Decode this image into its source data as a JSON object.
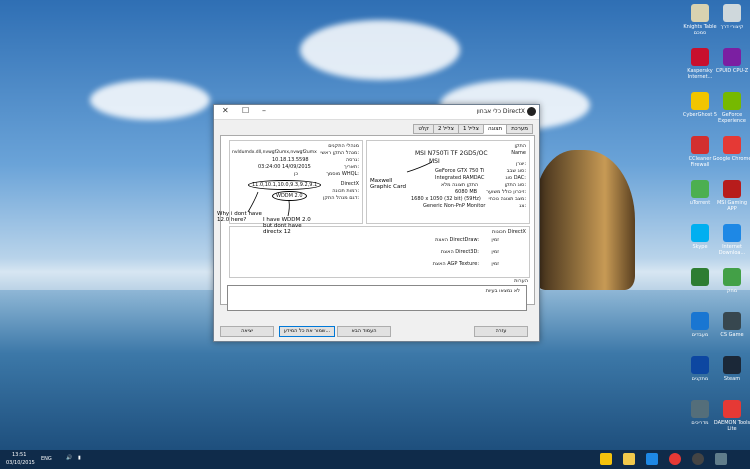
{
  "desktop_icons": [
    {
      "label": "Knights Table סמכם",
      "color": "#d9d2b0",
      "icon": "folder-icon"
    },
    {
      "label": "Kaspersky Internet...",
      "color": "#c8102e",
      "icon": "kaspersky-icon"
    },
    {
      "label": "CyberGhost 5",
      "color": "#f2c500",
      "icon": "cyberghost-icon"
    },
    {
      "label": "CCleaner Firewall",
      "color": "#d32f2f",
      "icon": "ccleaner-icon"
    },
    {
      "label": "uTorrent",
      "color": "#4caf50",
      "icon": "utorrent-icon"
    },
    {
      "label": "Skype",
      "color": "#00aff0",
      "icon": "skype-icon"
    },
    {
      "label": "",
      "color": "#2e7d32",
      "icon": "app-icon"
    },
    {
      "label": "מעבדים",
      "color": "#1976d2",
      "icon": "folder-icon"
    },
    {
      "label": "מתקנים",
      "color": "#0d47a1",
      "icon": "tools-icon"
    },
    {
      "label": "מדריכים",
      "color": "#546e7a",
      "icon": "tools-icon"
    }
  ],
  "desktop_icons_col2": [
    {
      "label": "קיצורי דרך",
      "color": "#cfd8dc",
      "icon": "folder-icon"
    },
    {
      "label": "CPUID CPU-Z",
      "color": "#7b1fa2",
      "icon": "cpuz-icon"
    },
    {
      "label": "GeForce Experience",
      "color": "#76b900",
      "icon": "geforce-icon"
    },
    {
      "label": "Google Chrome",
      "color": "#e53935",
      "icon": "chrome-icon"
    },
    {
      "label": "MSI Gaming APP",
      "color": "#b71c1c",
      "icon": "msi-icon"
    },
    {
      "label": "Internet Downloa...",
      "color": "#1e88e5",
      "icon": "download-icon"
    },
    {
      "label": "מחק",
      "color": "#43a047",
      "icon": "app-icon"
    },
    {
      "label": "CS Game",
      "color": "#37474f",
      "icon": "game-icon"
    },
    {
      "label": "Steam",
      "color": "#1b2838",
      "icon": "steam-icon"
    },
    {
      "label": "DAEMON Tools Lite",
      "color": "#e53935",
      "icon": "daemon-icon"
    }
  ],
  "window": {
    "title": "כלי אבחון DirectX",
    "minimize": "–",
    "maximize": "☐",
    "close": "✕",
    "tabs": [
      "מערכת",
      "תצוגה",
      "צליל 1",
      "צליל 2",
      "קלט"
    ],
    "active_tab": 1,
    "device_group": {
      "labels": [
        "התקן",
        "Name",
        "יצרן:",
        "סוג שבב:",
        "סוג DAC:",
        "סוג התקן:",
        "זיכרון כולל משוער:",
        "מצב תצוגה נוכחי:",
        "צג:"
      ],
      "values": [
        "MSI N750Ti TF 2GD5/OC",
        "MSI",
        "GeForce GTX 750 Ti",
        "Integrated RAMDAC",
        "התקן תצוגה מלא",
        "6080 MB",
        "1680 x 1050 (32 bit) (59Hz)",
        "Generic Non-PnP Monitor"
      ]
    },
    "drivers_group": {
      "labels": [
        "מנהלי התקנים",
        "מנהל התקן ראשי:",
        "גרסה:",
        "תאריך:",
        "מוסמך WHQL:",
        "DirectX",
        "רמות תכונה:",
        "דגם מנהל התקן:"
      ],
      "values": [
        "nvldumdx.dll,nvwgf2umx,nvwgf2umx",
        "10.18.13.5598",
        "03:24:00 14/09/2015",
        "כן",
        "11.0,10.1,10.0,9.3,9.2,9.1",
        "WDDM 2.0"
      ]
    },
    "features_group": {
      "title": "תכונות DirectX",
      "rows": [
        {
          "label": "האצת DirectDraw:",
          "value": "זמין"
        },
        {
          "label": "האצת Direct3D:",
          "value": "זמין"
        },
        {
          "label": "האצת AGP Texture:",
          "value": "זמין"
        }
      ]
    },
    "notes": {
      "title": "הערות",
      "text": "לא נמצאו בעיות"
    },
    "buttons": {
      "help": "עזרה",
      "next_page": "העמוד הבא",
      "save_all": "שמור את כל המידע...",
      "exit": "יציאה"
    }
  },
  "annotations": {
    "msi_arrow": "Maxwell Graphic Card",
    "feature_question": "Why i dont have 12.0 here?",
    "wddm_note": "I have WDDM 2.0 but dont have directx 12"
  },
  "taskbar": {
    "time": "13:51",
    "date": "03/10/2015",
    "lang": "ENG"
  }
}
